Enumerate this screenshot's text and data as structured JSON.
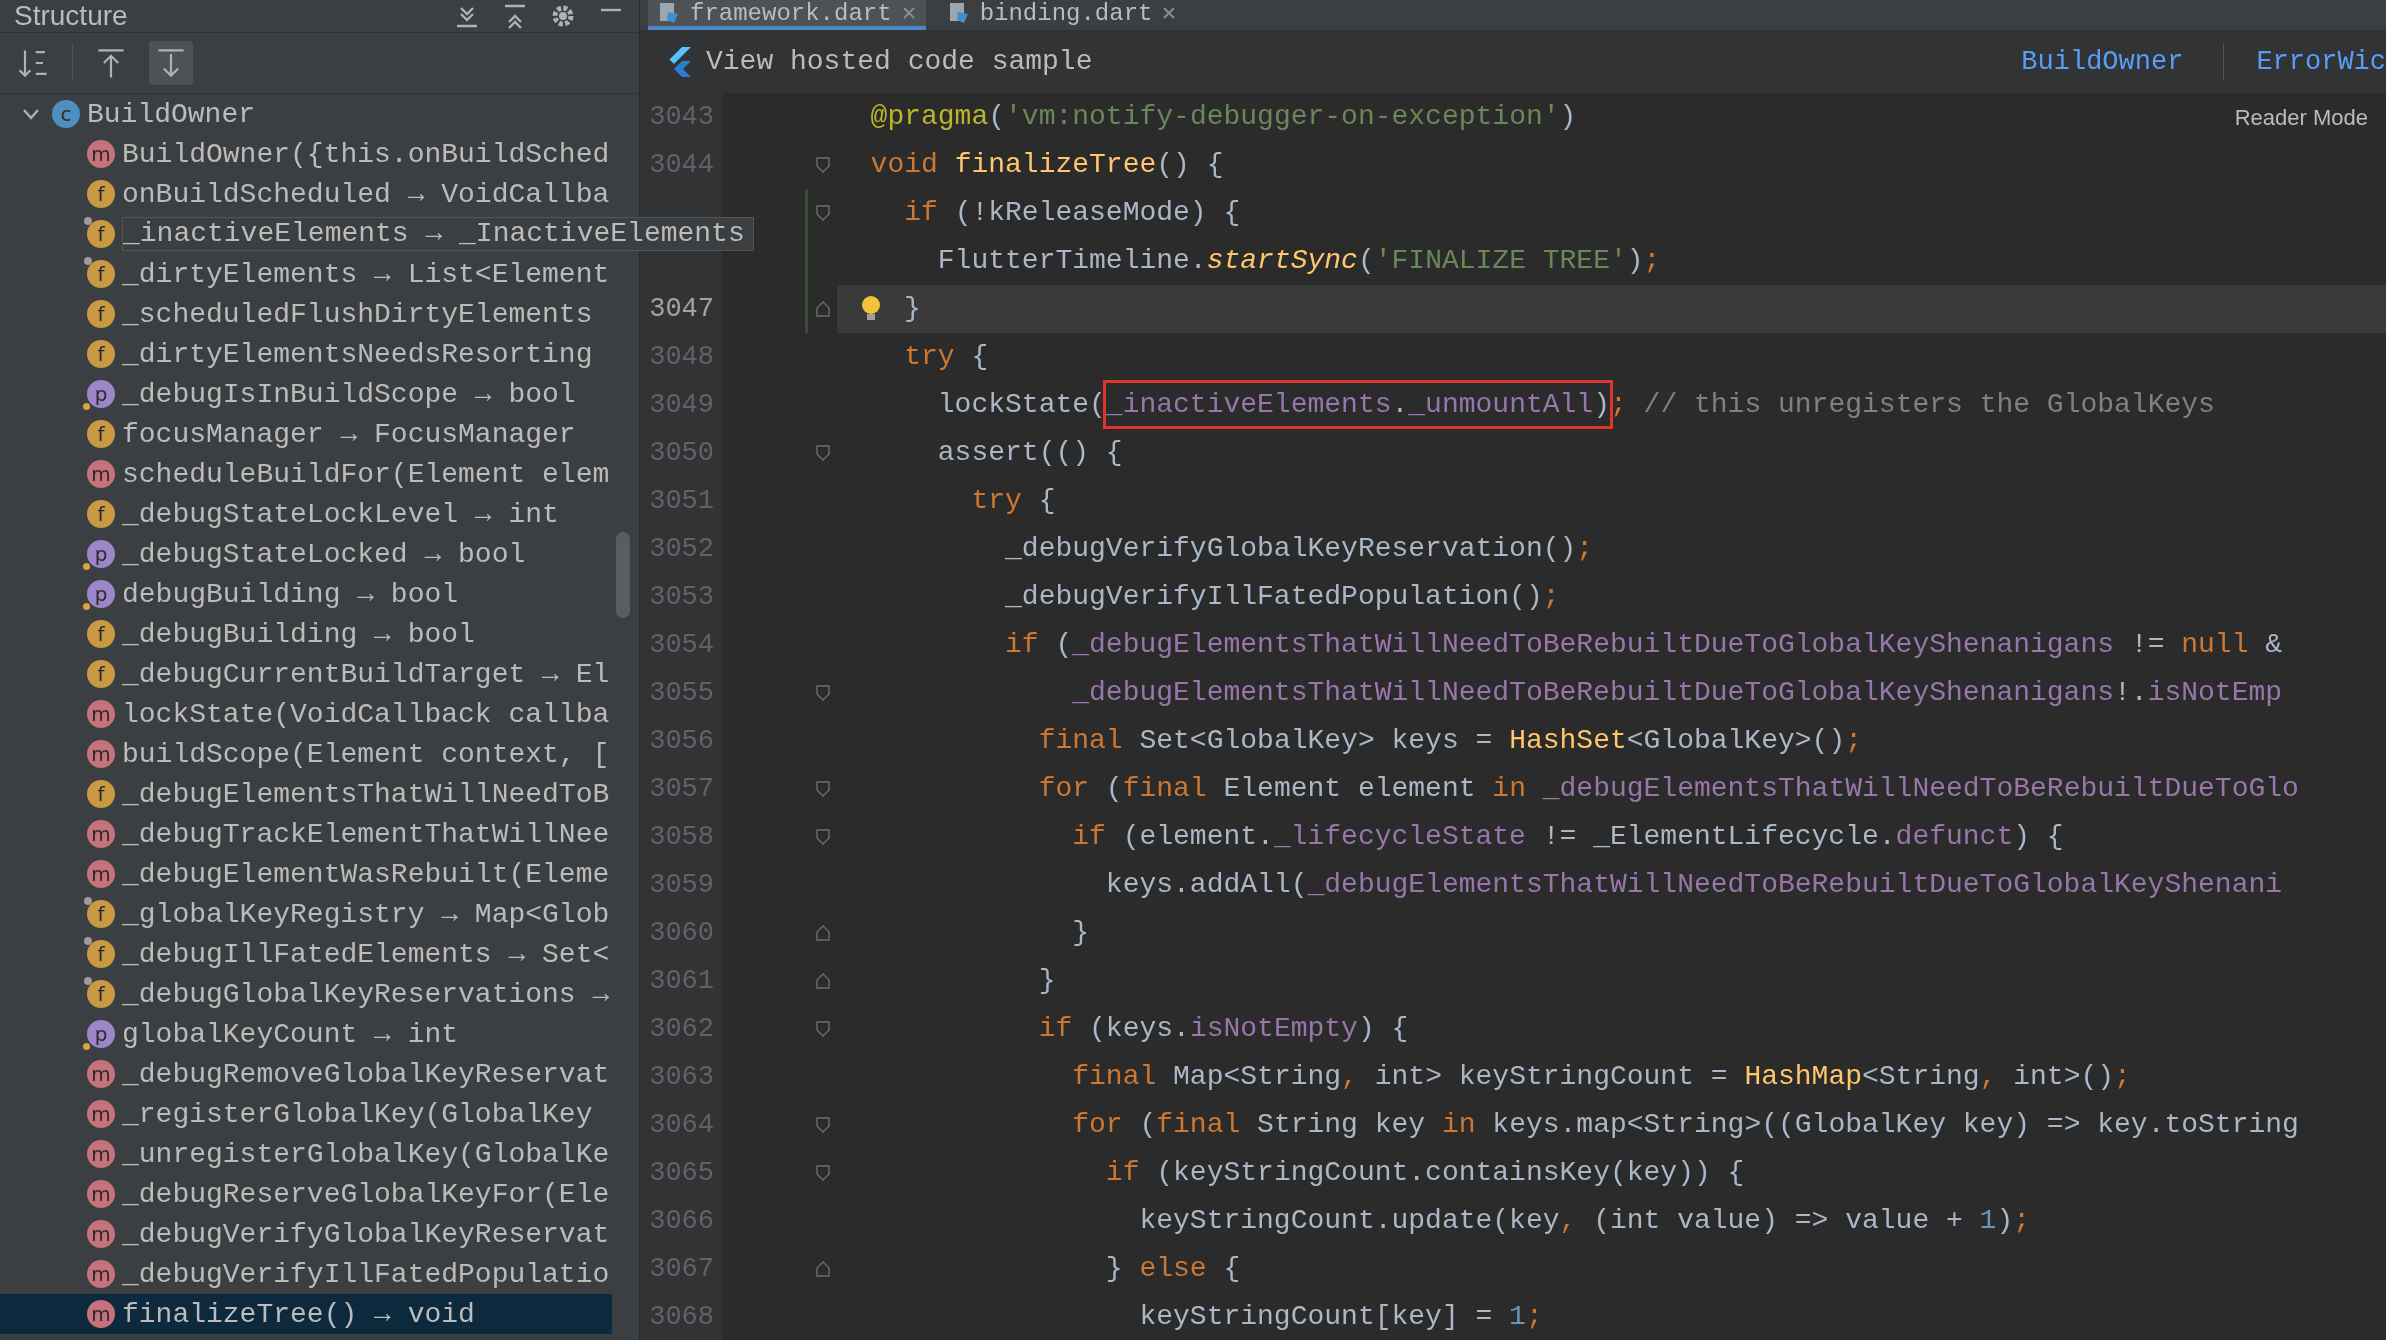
{
  "structure_panel": {
    "title": "Structure",
    "toolbar": [
      {
        "kind": "sort",
        "on": false
      },
      {
        "kind": "scroll-from",
        "on": false
      },
      {
        "kind": "scroll-to",
        "on": true
      }
    ],
    "tree": [
      {
        "label": "BuildOwner",
        "kind": "class",
        "badge": "c",
        "expanded": true,
        "selected": false,
        "children": [
          {
            "label": "BuildOwner({this.onBuildSched",
            "kind": "method",
            "badge": "m",
            "pin": false,
            "selected": false,
            "popup": false
          },
          {
            "label": "onBuildScheduled → VoidCallba",
            "kind": "field",
            "badge": "f",
            "pin": false,
            "selected": false,
            "popup": false
          },
          {
            "label": "_inactiveElements → _InactiveElements",
            "kind": "field",
            "badge": "f",
            "pin": true,
            "selected": false,
            "popup": true
          },
          {
            "label": "_dirtyElements → List<Element",
            "kind": "field",
            "badge": "f",
            "pin": true,
            "selected": false,
            "popup": false
          },
          {
            "label": "_scheduledFlushDirtyElements",
            "kind": "field",
            "badge": "f",
            "pin": false,
            "selected": false,
            "popup": false
          },
          {
            "label": "_dirtyElementsNeedsResorting",
            "kind": "field",
            "badge": "f",
            "pin": false,
            "selected": false,
            "popup": false
          },
          {
            "label": "_debugIsInBuildScope → bool",
            "kind": "property",
            "badge": "p",
            "pin": false,
            "selected": false,
            "popup": false
          },
          {
            "label": "focusManager → FocusManager",
            "kind": "field",
            "badge": "f",
            "pin": false,
            "selected": false,
            "popup": false
          },
          {
            "label": "scheduleBuildFor(Element elem",
            "kind": "method",
            "badge": "m",
            "pin": false,
            "selected": false,
            "popup": false
          },
          {
            "label": "_debugStateLockLevel → int",
            "kind": "field",
            "badge": "f",
            "pin": false,
            "selected": false,
            "popup": false
          },
          {
            "label": "_debugStateLocked → bool",
            "kind": "property",
            "badge": "p",
            "pin": false,
            "selected": false,
            "popup": false
          },
          {
            "label": "debugBuilding → bool",
            "kind": "property",
            "badge": "p",
            "pin": false,
            "selected": false,
            "popup": false
          },
          {
            "label": "_debugBuilding → bool",
            "kind": "field",
            "badge": "f",
            "pin": false,
            "selected": false,
            "popup": false
          },
          {
            "label": "_debugCurrentBuildTarget → El",
            "kind": "field",
            "badge": "f",
            "pin": false,
            "selected": false,
            "popup": false
          },
          {
            "label": "lockState(VoidCallback callba",
            "kind": "method",
            "badge": "m",
            "pin": false,
            "selected": false,
            "popup": false
          },
          {
            "label": "buildScope(Element context, [",
            "kind": "method",
            "badge": "m",
            "pin": false,
            "selected": false,
            "popup": false
          },
          {
            "label": "_debugElementsThatWillNeedToB",
            "kind": "field",
            "badge": "f",
            "pin": false,
            "selected": false,
            "popup": false
          },
          {
            "label": "_debugTrackElementThatWillNee",
            "kind": "method",
            "badge": "m",
            "pin": false,
            "selected": false,
            "popup": false
          },
          {
            "label": "_debugElementWasRebuilt(Eleme",
            "kind": "method",
            "badge": "m",
            "pin": false,
            "selected": false,
            "popup": false
          },
          {
            "label": "_globalKeyRegistry → Map<Glob",
            "kind": "field",
            "badge": "f",
            "pin": true,
            "selected": false,
            "popup": false
          },
          {
            "label": "_debugIllFatedElements → Set<",
            "kind": "field",
            "badge": "f",
            "pin": true,
            "selected": false,
            "popup": false
          },
          {
            "label": "_debugGlobalKeyReservations →",
            "kind": "field",
            "badge": "f",
            "pin": true,
            "selected": false,
            "popup": false
          },
          {
            "label": "globalKeyCount → int",
            "kind": "property",
            "badge": "p",
            "pin": false,
            "selected": false,
            "popup": false
          },
          {
            "label": "_debugRemoveGlobalKeyReservat",
            "kind": "method",
            "badge": "m",
            "pin": false,
            "selected": false,
            "popup": false
          },
          {
            "label": "_registerGlobalKey(GlobalKey",
            "kind": "method",
            "badge": "m",
            "pin": false,
            "selected": false,
            "popup": false
          },
          {
            "label": "_unregisterGlobalKey(GlobalKe",
            "kind": "method",
            "badge": "m",
            "pin": false,
            "selected": false,
            "popup": false
          },
          {
            "label": "_debugReserveGlobalKeyFor(Ele",
            "kind": "method",
            "badge": "m",
            "pin": false,
            "selected": false,
            "popup": false
          },
          {
            "label": "_debugVerifyGlobalKeyReservat",
            "kind": "method",
            "badge": "m",
            "pin": false,
            "selected": false,
            "popup": false
          },
          {
            "label": "_debugVerifyIllFatedPopulatio",
            "kind": "method",
            "badge": "m",
            "pin": false,
            "selected": false,
            "popup": false
          },
          {
            "label": "finalizeTree() → void",
            "kind": "method",
            "badge": "m",
            "pin": false,
            "selected": true,
            "popup": false
          }
        ]
      }
    ]
  },
  "editor": {
    "tabs": [
      {
        "label": "framework.dart",
        "selected": true
      },
      {
        "label": "binding.dart",
        "selected": false
      }
    ],
    "banner": {
      "text": "View hosted code sample",
      "links": [
        "BuildOwner",
        "ErrorWic"
      ]
    },
    "reader_mode": "Reader Mode",
    "lines": [
      {
        "number": "3043",
        "current": false,
        "changed": false,
        "bulb": false,
        "fold_start": false,
        "fold_end": false,
        "segments": [
          {
            "kind": "annotation",
            "text": "  @pragma"
          },
          {
            "kind": "plain",
            "text": "("
          },
          {
            "kind": "string",
            "text": "'vm:notify-debugger-on-exception'"
          },
          {
            "kind": "plain",
            "text": ")"
          }
        ]
      },
      {
        "number": "3044",
        "current": false,
        "changed": false,
        "bulb": false,
        "fold_start": true,
        "fold_end": false,
        "segments": [
          {
            "kind": "keyword",
            "text": "  void"
          },
          {
            "kind": "declaration",
            "text": " finalizeTree"
          },
          {
            "kind": "plain",
            "text": "() {"
          }
        ]
      },
      {
        "current": false,
        "changed": true,
        "bulb": false,
        "fold_start": true,
        "fold_end": false,
        "segments": [
          {
            "kind": "keyword",
            "text": "    if"
          },
          {
            "kind": "plain",
            "text": " (!kReleaseMode) {"
          }
        ]
      },
      {
        "current": false,
        "changed": true,
        "bulb": false,
        "fold_start": false,
        "fold_end": false,
        "segments": [
          {
            "kind": "plain",
            "text": "      FlutterTimeline."
          },
          {
            "kind": "static-call",
            "text": "startSync"
          },
          {
            "kind": "plain",
            "text": "("
          },
          {
            "kind": "string",
            "text": "'FINALIZE TREE'"
          },
          {
            "kind": "plain",
            "text": ")"
          },
          {
            "kind": "punct",
            "text": ";"
          }
        ]
      },
      {
        "number": "3047",
        "current": true,
        "changed": true,
        "bulb": true,
        "fold_start": false,
        "fold_end": true,
        "segments": [
          {
            "kind": "plain",
            "text": "}"
          }
        ]
      },
      {
        "number": "3048",
        "current": false,
        "changed": false,
        "bulb": false,
        "fold_start": false,
        "fold_end": false,
        "segments": [
          {
            "kind": "keyword",
            "text": "    try"
          },
          {
            "kind": "plain",
            "text": " {"
          }
        ]
      },
      {
        "number": "3049",
        "current": false,
        "changed": false,
        "bulb": false,
        "fold_start": false,
        "fold_end": false,
        "segments": [
          {
            "kind": "plain",
            "text": "      lockState(",
            "boxed": false
          },
          {
            "kind": "field",
            "text": "_inactiveElements",
            "boxed": true
          },
          {
            "kind": "plain",
            "text": ".",
            "boxed": true
          },
          {
            "kind": "field",
            "text": "_unmountAll",
            "boxed": true
          },
          {
            "kind": "plain",
            "text": ")",
            "boxed": true
          },
          {
            "kind": "punct",
            "text": ";",
            "boxed": false
          },
          {
            "kind": "comment",
            "text": " // this unregisters the GlobalKeys",
            "boxed": false
          }
        ]
      },
      {
        "number": "3050",
        "current": false,
        "changed": false,
        "bulb": false,
        "fold_start": true,
        "fold_end": false,
        "segments": [
          {
            "kind": "plain",
            "text": "      assert(() {"
          }
        ]
      },
      {
        "number": "3051",
        "current": false,
        "changed": false,
        "bulb": false,
        "fold_start": false,
        "fold_end": false,
        "segments": [
          {
            "kind": "keyword",
            "text": "        try"
          },
          {
            "kind": "plain",
            "text": " {"
          }
        ]
      },
      {
        "number": "3052",
        "current": false,
        "changed": false,
        "bulb": false,
        "fold_start": false,
        "fold_end": false,
        "segments": [
          {
            "kind": "plain",
            "text": "          _debugVerifyGlobalKeyReservation()"
          },
          {
            "kind": "punct",
            "text": ";"
          }
        ]
      },
      {
        "number": "3053",
        "current": false,
        "changed": false,
        "bulb": false,
        "fold_start": false,
        "fold_end": false,
        "segments": [
          {
            "kind": "plain",
            "text": "          _debugVerifyIllFatedPopulation()"
          },
          {
            "kind": "punct",
            "text": ";"
          }
        ]
      },
      {
        "number": "3054",
        "current": false,
        "changed": false,
        "bulb": false,
        "fold_start": false,
        "fold_end": false,
        "segments": [
          {
            "kind": "keyword",
            "text": "          if"
          },
          {
            "kind": "plain",
            "text": " ("
          },
          {
            "kind": "field",
            "text": "_debugElementsThatWillNeedToBeRebuiltDueToGlobalKeyShenanigans"
          },
          {
            "kind": "plain",
            "text": " != "
          },
          {
            "kind": "keyword",
            "text": "null"
          },
          {
            "kind": "plain",
            "text": " &"
          }
        ]
      },
      {
        "number": "3055",
        "current": false,
        "changed": false,
        "bulb": false,
        "fold_start": true,
        "fold_end": false,
        "segments": [
          {
            "kind": "field",
            "text": "              _debugElementsThatWillNeedToBeRebuiltDueToGlobalKeyShenanigans"
          },
          {
            "kind": "plain",
            "text": "!."
          },
          {
            "kind": "field",
            "text": "isNotEmp"
          }
        ]
      },
      {
        "number": "3056",
        "current": false,
        "changed": false,
        "bulb": false,
        "fold_start": false,
        "fold_end": false,
        "segments": [
          {
            "kind": "keyword",
            "text": "            final"
          },
          {
            "kind": "plain",
            "text": " Set<GlobalKey> keys = "
          },
          {
            "kind": "declaration",
            "text": "HashSet"
          },
          {
            "kind": "plain",
            "text": "<GlobalKey>()"
          },
          {
            "kind": "punct",
            "text": ";"
          }
        ]
      },
      {
        "number": "3057",
        "current": false,
        "changed": false,
        "bulb": false,
        "fold_start": true,
        "fold_end": false,
        "segments": [
          {
            "kind": "keyword",
            "text": "            for"
          },
          {
            "kind": "plain",
            "text": " ("
          },
          {
            "kind": "keyword",
            "text": "final"
          },
          {
            "kind": "plain",
            "text": " Element element "
          },
          {
            "kind": "keyword",
            "text": "in"
          },
          {
            "kind": "field",
            "text": " _debugElementsThatWillNeedToBeRebuiltDueToGlo"
          }
        ]
      },
      {
        "number": "3058",
        "current": false,
        "changed": false,
        "bulb": false,
        "fold_start": true,
        "fold_end": false,
        "segments": [
          {
            "kind": "keyword",
            "text": "              if"
          },
          {
            "kind": "plain",
            "text": " (element."
          },
          {
            "kind": "field",
            "text": "_lifecycleState"
          },
          {
            "kind": "plain",
            "text": " != _ElementLifecycle."
          },
          {
            "kind": "field",
            "text": "defunct"
          },
          {
            "kind": "plain",
            "text": ") {"
          }
        ]
      },
      {
        "number": "3059",
        "current": false,
        "changed": false,
        "bulb": false,
        "fold_start": false,
        "fold_end": false,
        "segments": [
          {
            "kind": "plain",
            "text": "                keys.addAll("
          },
          {
            "kind": "field",
            "text": "_debugElementsThatWillNeedToBeRebuiltDueToGlobalKeyShenani"
          }
        ]
      },
      {
        "number": "3060",
        "current": false,
        "changed": false,
        "bulb": false,
        "fold_start": false,
        "fold_end": true,
        "segments": [
          {
            "kind": "plain",
            "text": "              }"
          }
        ]
      },
      {
        "number": "3061",
        "current": false,
        "changed": false,
        "bulb": false,
        "fold_start": false,
        "fold_end": true,
        "segments": [
          {
            "kind": "plain",
            "text": "            }"
          }
        ]
      },
      {
        "number": "3062",
        "current": false,
        "changed": false,
        "bulb": false,
        "fold_start": true,
        "fold_end": false,
        "segments": [
          {
            "kind": "keyword",
            "text": "            if"
          },
          {
            "kind": "plain",
            "text": " (keys."
          },
          {
            "kind": "field",
            "text": "isNotEmpty"
          },
          {
            "kind": "plain",
            "text": ") {"
          }
        ]
      },
      {
        "number": "3063",
        "current": false,
        "changed": false,
        "bulb": false,
        "fold_start": false,
        "fold_end": false,
        "segments": [
          {
            "kind": "keyword",
            "text": "              final"
          },
          {
            "kind": "plain",
            "text": " Map<String"
          },
          {
            "kind": "punct",
            "text": ","
          },
          {
            "kind": "plain",
            "text": " int> keyStringCount = "
          },
          {
            "kind": "declaration",
            "text": "HashMap"
          },
          {
            "kind": "plain",
            "text": "<String"
          },
          {
            "kind": "punct",
            "text": ","
          },
          {
            "kind": "plain",
            "text": " int>()"
          },
          {
            "kind": "punct",
            "text": ";"
          }
        ]
      },
      {
        "number": "3064",
        "current": false,
        "changed": false,
        "bulb": false,
        "fold_start": true,
        "fold_end": false,
        "segments": [
          {
            "kind": "keyword",
            "text": "              for"
          },
          {
            "kind": "plain",
            "text": " ("
          },
          {
            "kind": "keyword",
            "text": "final"
          },
          {
            "kind": "plain",
            "text": " String key "
          },
          {
            "kind": "keyword",
            "text": "in"
          },
          {
            "kind": "plain",
            "text": " keys.map<String>((GlobalKey key) => key.toString"
          }
        ]
      },
      {
        "number": "3065",
        "current": false,
        "changed": false,
        "bulb": false,
        "fold_start": true,
        "fold_end": false,
        "segments": [
          {
            "kind": "keyword",
            "text": "                if"
          },
          {
            "kind": "plain",
            "text": " (keyStringCount.containsKey(key)) {"
          }
        ]
      },
      {
        "number": "3066",
        "current": false,
        "changed": false,
        "bulb": false,
        "fold_start": false,
        "fold_end": false,
        "segments": [
          {
            "kind": "plain",
            "text": "                  keyStringCount.update(key"
          },
          {
            "kind": "punct",
            "text": ","
          },
          {
            "kind": "plain",
            "text": " (int value) => value + "
          },
          {
            "kind": "number",
            "text": "1"
          },
          {
            "kind": "plain",
            "text": ")"
          },
          {
            "kind": "punct",
            "text": ";"
          }
        ]
      },
      {
        "number": "3067",
        "current": false,
        "changed": false,
        "bulb": false,
        "fold_start": false,
        "fold_end": true,
        "segments": [
          {
            "kind": "plain",
            "text": "                } "
          },
          {
            "kind": "keyword",
            "text": "else"
          },
          {
            "kind": "plain",
            "text": " {"
          }
        ]
      },
      {
        "number": "3068",
        "current": false,
        "changed": false,
        "bulb": false,
        "fold_start": false,
        "fold_end": false,
        "segments": [
          {
            "kind": "plain",
            "text": "                  keyStringCount[key] = "
          },
          {
            "kind": "number",
            "text": "1"
          },
          {
            "kind": "punct",
            "text": ";"
          }
        ]
      }
    ]
  }
}
